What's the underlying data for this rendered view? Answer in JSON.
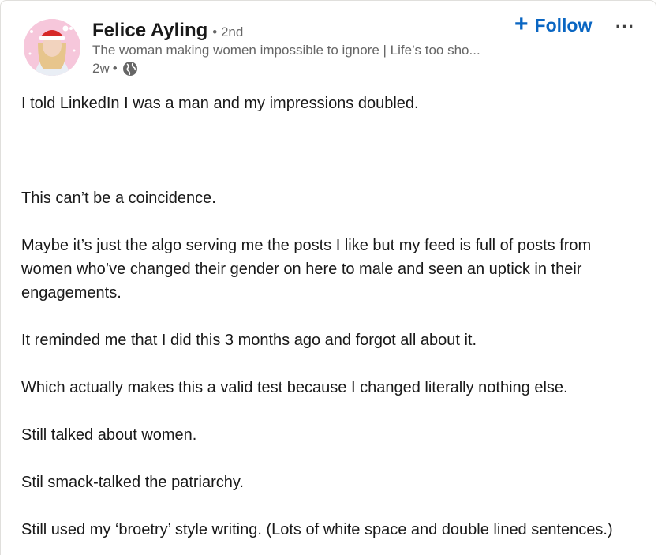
{
  "author": {
    "name": "Felice Ayling",
    "degree": "• 2nd",
    "headline": "The woman making women impossible to ignore | Life’s too sho...",
    "age": "2w",
    "separator": "•",
    "visibility_icon": "globe-icon"
  },
  "actions": {
    "follow_plus": "+",
    "follow_label": "Follow",
    "more_label": "···"
  },
  "post": {
    "paragraphs": [
      "I told LinkedIn I was a man and my impressions doubled.",
      "This can’t be a coincidence.",
      "Maybe it’s just the algo serving me the posts I like but my feed is full of posts from women who’ve changed their gender on here to male and seen an uptick in their engagements.",
      "It reminded me that I did this 3 months ago and forgot all about it.",
      "Which actually makes this a valid test because I changed literally nothing else.",
      "Still talked about women.",
      "Stil smack-talked the patriarchy.",
      "Still used my ‘broetry’ style writing. (Lots of white space and double lined sentences.)"
    ]
  },
  "colors": {
    "accent": "#0a66c2",
    "text": "#191919",
    "muted": "#666666",
    "avatar_bg": "#f6c7db"
  }
}
